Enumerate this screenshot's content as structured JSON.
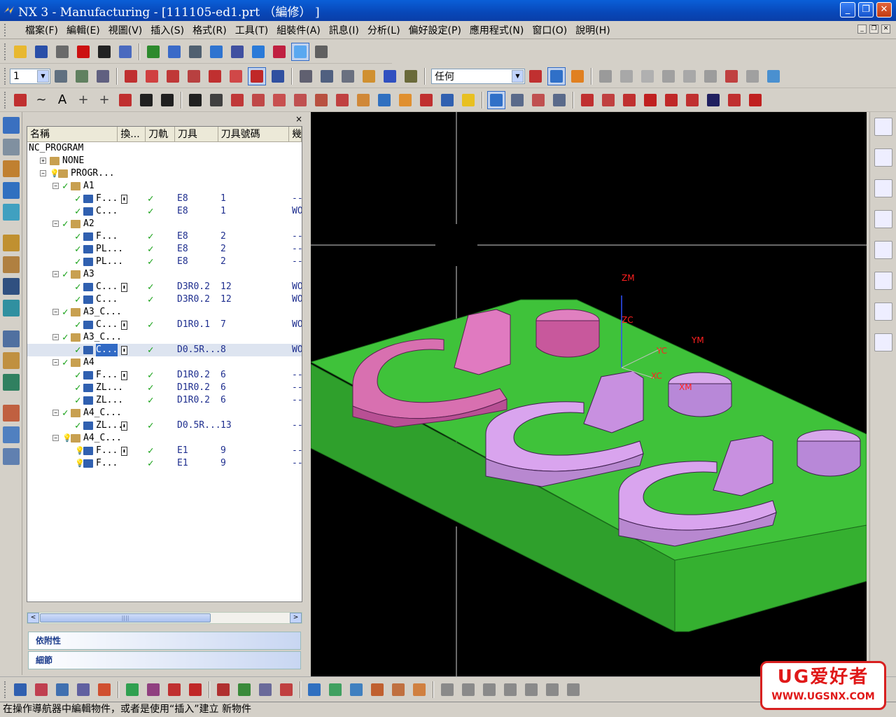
{
  "window": {
    "title": "NX 3 - Manufacturing - [111105-ed1.prt （編修） ]",
    "min_glyph": "_",
    "max_glyph": "❐",
    "close_glyph": "✕"
  },
  "menu": {
    "items": [
      "檔案(F)",
      "編輯(E)",
      "視圖(V)",
      "插入(S)",
      "格式(R)",
      "工具(T)",
      "組裝件(A)",
      "訊息(I)",
      "分析(L)",
      "偏好設定(P)",
      "應用程式(N)",
      "窗口(O)",
      "說明(H)"
    ],
    "mdi_buttons": [
      "_",
      "❐",
      "✕"
    ]
  },
  "toolbar1": {
    "buttons": [
      {
        "name": "open-icon",
        "color": "#e8b830"
      },
      {
        "name": "save-icon",
        "color": "#2a4fa8"
      },
      {
        "name": "print-icon",
        "color": "#6a6a6a"
      },
      {
        "name": "delete-icon",
        "color": "#cc1010"
      },
      {
        "name": "undo-icon",
        "color": "#222222"
      },
      {
        "name": "repeat-icon",
        "color": "#4a6abf"
      },
      {
        "name": "refresh-icon",
        "color": "#2d8a2d"
      },
      {
        "name": "fit-icon",
        "color": "#3a6ac8"
      },
      {
        "name": "orient-icon",
        "color": "#506070"
      },
      {
        "name": "shaded-icon",
        "color": "#2f74d0"
      },
      {
        "name": "wireframe-icon",
        "color": "#4050a0"
      },
      {
        "name": "view-cube-icon",
        "color": "#2a7ad8"
      },
      {
        "name": "render-icon",
        "color": "#c02040"
      },
      {
        "name": "view-front-icon",
        "color": "#5aa8f0"
      },
      {
        "name": "hat-icon",
        "color": "#606060"
      }
    ]
  },
  "toolbar2": {
    "layer_value": "1",
    "filter_value": "任何",
    "buttons": [
      {
        "name": "layer-icon",
        "color": "#607080"
      },
      {
        "name": "move-layer-icon",
        "color": "#608060"
      },
      {
        "name": "copy-layer-icon",
        "color": "#606080"
      },
      {
        "name": "wcs-origin-icon",
        "color": "#c03030"
      },
      {
        "name": "wcs-dynamic-icon",
        "color": "#d04040"
      },
      {
        "name": "wcs-rotate-icon",
        "color": "#c03838"
      },
      {
        "name": "wcs-orient-icon",
        "color": "#b84040"
      },
      {
        "name": "wcs-xc-icon",
        "color": "#c03030"
      },
      {
        "name": "wcs-set-icon",
        "color": "#d04848"
      },
      {
        "name": "wcs-active-icon",
        "color": "#c02828"
      },
      {
        "name": "wcs-save-icon",
        "color": "#3050a0"
      },
      {
        "name": "part-nav-icon",
        "color": "#606070"
      },
      {
        "name": "assy-icon",
        "color": "#506080"
      },
      {
        "name": "assy2-icon",
        "color": "#6a7080"
      },
      {
        "name": "prop-icon",
        "color": "#d09030"
      },
      {
        "name": "measure-icon",
        "color": "#3050c0"
      },
      {
        "name": "ruler-icon",
        "color": "#6a6a3a"
      },
      {
        "name": "snap-point-icon",
        "color": "#c03030"
      },
      {
        "name": "snap-active-icon",
        "color": "#3070c8"
      },
      {
        "name": "snap-box-icon",
        "color": "#e08020"
      },
      {
        "name": "palette-icon",
        "color": "#9a9a9a"
      },
      {
        "name": "point-icon",
        "color": "#a8a8a8"
      },
      {
        "name": "center-icon",
        "color": "#b0b0b0"
      },
      {
        "name": "arc-icon",
        "color": "#a0a0a0"
      },
      {
        "name": "grid-icon",
        "color": "#a8a8a8"
      },
      {
        "name": "chain-icon",
        "color": "#9c9c9c"
      },
      {
        "name": "rotate-icon",
        "color": "#c04040"
      },
      {
        "name": "key-icon",
        "color": "#a0a0a0"
      },
      {
        "name": "cube-icon",
        "color": "#4a90d0"
      }
    ]
  },
  "toolbar3": {
    "buttons": [
      {
        "name": "point-tool-icon",
        "color": "#c03030",
        "glyph": ""
      },
      {
        "name": "spline-icon",
        "color": "#202020",
        "glyph": "~"
      },
      {
        "name": "text-icon",
        "color": "#000000",
        "glyph": "A"
      },
      {
        "name": "point-plus-icon",
        "color": "#404040",
        "glyph": "+"
      },
      {
        "name": "points-icon",
        "color": "#404040",
        "glyph": "+"
      },
      {
        "name": "fillet-icon",
        "color": "#c03030",
        "glyph": ""
      },
      {
        "name": "rect-icon",
        "color": "#202020",
        "glyph": ""
      },
      {
        "name": "polygon-icon",
        "color": "#202020",
        "glyph": ""
      },
      {
        "name": "ellipse-icon",
        "color": "#202020",
        "glyph": ""
      },
      {
        "name": "helix-icon",
        "color": "#404040",
        "glyph": ""
      },
      {
        "name": "curve-op1-icon",
        "color": "#c03838",
        "glyph": ""
      },
      {
        "name": "curve-op2-icon",
        "color": "#c04848",
        "glyph": ""
      },
      {
        "name": "curve-op3-icon",
        "color": "#c85050",
        "glyph": ""
      },
      {
        "name": "curve-op4-icon",
        "color": "#c05050",
        "glyph": ""
      },
      {
        "name": "curve-op5-icon",
        "color": "#b85040",
        "glyph": ""
      },
      {
        "name": "offset-icon",
        "color": "#c04040",
        "glyph": ""
      },
      {
        "name": "bridge-icon",
        "color": "#d08838",
        "glyph": ""
      },
      {
        "name": "project-icon",
        "color": "#3070c0",
        "glyph": ""
      },
      {
        "name": "combine-icon",
        "color": "#e09030",
        "glyph": ""
      },
      {
        "name": "mirror-icon",
        "color": "#c03030",
        "glyph": ""
      },
      {
        "name": "wrap-icon",
        "color": "#3060b0",
        "glyph": ""
      },
      {
        "name": "yellow-arrow-icon",
        "color": "#e8c020",
        "glyph": ""
      },
      {
        "name": "trim-icon",
        "color": "#3070c8",
        "glyph": ""
      },
      {
        "name": "split-icon",
        "color": "#5a6a8a",
        "glyph": ""
      },
      {
        "name": "stretch-icon",
        "color": "#c05050",
        "glyph": ""
      },
      {
        "name": "edit-curve-icon",
        "color": "#5a6a8a",
        "glyph": ""
      },
      {
        "name": "length-icon",
        "color": "#c03030",
        "glyph": ""
      },
      {
        "name": "edit-param-icon",
        "color": "#c04040",
        "glyph": ""
      },
      {
        "name": "trim-corner-icon",
        "color": "#c03030",
        "glyph": ""
      },
      {
        "name": "divide-icon",
        "color": "#c02020",
        "glyph": ""
      },
      {
        "name": "fillet-edit-icon",
        "color": "#c02828",
        "glyph": ""
      },
      {
        "name": "chamfer-icon",
        "color": "#c03030",
        "glyph": ""
      },
      {
        "name": "smooth-icon",
        "color": "#202060",
        "glyph": ""
      },
      {
        "name": "blend-icon",
        "color": "#c03030",
        "glyph": ""
      },
      {
        "name": "spline-edit-icon",
        "color": "#c02020",
        "glyph": ""
      }
    ]
  },
  "navigator": {
    "close_glyph": "×",
    "columns": [
      "名稱",
      "換...",
      "刀軌",
      "刀具",
      "刀具號碼",
      "幾"
    ],
    "rows": [
      {
        "level": 0,
        "expand": "",
        "icon": "",
        "name": "NC_PROGRAM",
        "check": false,
        "bulb": false,
        "tc": false,
        "path": false,
        "tool": "",
        "num": "",
        "geom": "",
        "selected": false
      },
      {
        "level": 1,
        "expand": "+",
        "icon": "#c8a050",
        "name": "NONE",
        "check": false,
        "bulb": false,
        "tc": false,
        "path": false,
        "tool": "",
        "num": "",
        "geom": "",
        "selected": false
      },
      {
        "level": 1,
        "expand": "−",
        "icon": "#c8a050",
        "name": "PROGR...",
        "check": false,
        "bulb": true,
        "tc": false,
        "path": false,
        "tool": "",
        "num": "",
        "geom": "",
        "selected": false
      },
      {
        "level": 2,
        "expand": "−",
        "icon": "#c8a050",
        "name": "A1",
        "check": true,
        "bulb": false,
        "tc": false,
        "path": false,
        "tool": "",
        "num": "",
        "geom": "",
        "selected": false
      },
      {
        "level": 3,
        "expand": "",
        "icon": "#3060b0",
        "name": "F...",
        "check": true,
        "bulb": false,
        "tc": true,
        "path": true,
        "tool": "E8",
        "num": "1",
        "geom": "---",
        "selected": false
      },
      {
        "level": 3,
        "expand": "",
        "icon": "#3060b0",
        "name": "C...",
        "check": true,
        "bulb": false,
        "tc": false,
        "path": true,
        "tool": "E8",
        "num": "1",
        "geom": "WO",
        "selected": false
      },
      {
        "level": 2,
        "expand": "−",
        "icon": "#c8a050",
        "name": "A2",
        "check": true,
        "bulb": false,
        "tc": false,
        "path": false,
        "tool": "",
        "num": "",
        "geom": "",
        "selected": false
      },
      {
        "level": 3,
        "expand": "",
        "icon": "#3060b0",
        "name": "F...",
        "check": true,
        "bulb": false,
        "tc": false,
        "path": true,
        "tool": "E8",
        "num": "2",
        "geom": "---",
        "selected": false
      },
      {
        "level": 3,
        "expand": "",
        "icon": "#3060b0",
        "name": "PL...",
        "check": true,
        "bulb": false,
        "tc": false,
        "path": true,
        "tool": "E8",
        "num": "2",
        "geom": "---",
        "selected": false
      },
      {
        "level": 3,
        "expand": "",
        "icon": "#3060b0",
        "name": "PL...",
        "check": true,
        "bulb": false,
        "tc": false,
        "path": true,
        "tool": "E8",
        "num": "2",
        "geom": "---",
        "selected": false
      },
      {
        "level": 2,
        "expand": "−",
        "icon": "#c8a050",
        "name": "A3",
        "check": true,
        "bulb": false,
        "tc": false,
        "path": false,
        "tool": "",
        "num": "",
        "geom": "",
        "selected": false
      },
      {
        "level": 3,
        "expand": "",
        "icon": "#3060b0",
        "name": "C...",
        "check": true,
        "bulb": false,
        "tc": true,
        "path": true,
        "tool": "D3R0.2",
        "num": "12",
        "geom": "WO",
        "selected": false
      },
      {
        "level": 3,
        "expand": "",
        "icon": "#3060b0",
        "name": "C...",
        "check": true,
        "bulb": false,
        "tc": false,
        "path": true,
        "tool": "D3R0.2",
        "num": "12",
        "geom": "WO",
        "selected": false
      },
      {
        "level": 2,
        "expand": "−",
        "icon": "#c8a050",
        "name": "A3_C...",
        "check": true,
        "bulb": false,
        "tc": false,
        "path": false,
        "tool": "",
        "num": "",
        "geom": "",
        "selected": false
      },
      {
        "level": 3,
        "expand": "",
        "icon": "#3060b0",
        "name": "C...",
        "check": true,
        "bulb": false,
        "tc": true,
        "path": true,
        "tool": "D1R0.1",
        "num": "7",
        "geom": "WO",
        "selected": false
      },
      {
        "level": 2,
        "expand": "−",
        "icon": "#c8a050",
        "name": "A3_C...",
        "check": true,
        "bulb": false,
        "tc": false,
        "path": false,
        "tool": "",
        "num": "",
        "geom": "",
        "selected": false
      },
      {
        "level": 3,
        "expand": "",
        "icon": "#3060b0",
        "name": "C...",
        "check": true,
        "bulb": false,
        "tc": true,
        "path": true,
        "tool": "D0.5R...",
        "num": "8",
        "geom": "WO",
        "selected": true
      },
      {
        "level": 2,
        "expand": "−",
        "icon": "#c8a050",
        "name": "A4",
        "check": true,
        "bulb": false,
        "tc": false,
        "path": false,
        "tool": "",
        "num": "",
        "geom": "",
        "selected": false
      },
      {
        "level": 3,
        "expand": "",
        "icon": "#3060b0",
        "name": "F...",
        "check": true,
        "bulb": false,
        "tc": true,
        "path": true,
        "tool": "D1R0.2",
        "num": "6",
        "geom": "---",
        "selected": false
      },
      {
        "level": 3,
        "expand": "",
        "icon": "#3060b0",
        "name": "ZL...",
        "check": true,
        "bulb": false,
        "tc": false,
        "path": true,
        "tool": "D1R0.2",
        "num": "6",
        "geom": "---",
        "selected": false
      },
      {
        "level": 3,
        "expand": "",
        "icon": "#3060b0",
        "name": "ZL...",
        "check": true,
        "bulb": false,
        "tc": false,
        "path": true,
        "tool": "D1R0.2",
        "num": "6",
        "geom": "---",
        "selected": false
      },
      {
        "level": 2,
        "expand": "−",
        "icon": "#c8a050",
        "name": "A4_C...",
        "check": true,
        "bulb": false,
        "tc": false,
        "path": false,
        "tool": "",
        "num": "",
        "geom": "",
        "selected": false
      },
      {
        "level": 3,
        "expand": "",
        "icon": "#3060b0",
        "name": "ZL...",
        "check": true,
        "bulb": false,
        "tc": true,
        "path": true,
        "tool": "D0.5R...",
        "num": "13",
        "geom": "---",
        "selected": false
      },
      {
        "level": 2,
        "expand": "−",
        "icon": "#c8a050",
        "name": "A4_C...",
        "check": false,
        "bulb": true,
        "tc": false,
        "path": false,
        "tool": "",
        "num": "",
        "geom": "",
        "selected": false
      },
      {
        "level": 3,
        "expand": "",
        "icon": "#3060b0",
        "name": "F...",
        "check": false,
        "bulb": true,
        "tc": true,
        "path": true,
        "tool": "E1",
        "num": "9",
        "geom": "---",
        "selected": false
      },
      {
        "level": 3,
        "expand": "",
        "icon": "#3060b0",
        "name": "F...",
        "check": false,
        "bulb": true,
        "tc": false,
        "path": true,
        "tool": "E1",
        "num": "9",
        "geom": "---",
        "selected": false
      }
    ],
    "scroll_left": "<",
    "scroll_right": ">",
    "scroll_grip": "||||",
    "panel_dependencies": "依附性",
    "panel_details": "細節"
  },
  "viewport": {
    "labels": [
      "ZM",
      "ZC",
      "YC",
      "YM",
      "XC",
      "XM"
    ],
    "colors": {
      "background": "#000000",
      "base": "#3fc23a",
      "base_side": "#2fa02c",
      "part_pink": "#d870b0",
      "part_purple": "#c890e0"
    }
  },
  "right_strip": {
    "buttons": [
      "assembly-nav-icon",
      "constraint-nav-icon",
      "part-nav-icon",
      "web-browser-icon",
      "training-icon",
      "help-icon",
      "history-icon",
      "system-materials-icon"
    ]
  },
  "bottom_toolbar": {
    "buttons": [
      {
        "name": "create-program-icon",
        "color": "#3060b0"
      },
      {
        "name": "create-tool-icon",
        "color": "#c04050"
      },
      {
        "name": "create-geometry-icon",
        "color": "#4070b0"
      },
      {
        "name": "create-method-icon",
        "color": "#6060a0"
      },
      {
        "name": "create-operation-icon",
        "color": "#d05030"
      },
      {
        "name": "generate-icon",
        "color": "#30a050"
      },
      {
        "name": "replay-icon",
        "color": "#904080"
      },
      {
        "name": "verify-icon",
        "color": "#c03030"
      },
      {
        "name": "postprocess-icon",
        "color": "#c02828"
      },
      {
        "name": "shop-doc-icon",
        "color": "#b03030"
      },
      {
        "name": "list-path-icon",
        "color": "#3a8a3a"
      },
      {
        "name": "edit-display-icon",
        "color": "#6a6a9a"
      },
      {
        "name": "transform-icon",
        "color": "#c04040"
      },
      {
        "name": "export-icon",
        "color": "#3070c0"
      },
      {
        "name": "library-icon",
        "color": "#40a060"
      },
      {
        "name": "featureless-icon",
        "color": "#4080c0"
      },
      {
        "name": "cut-region-icon",
        "color": "#c06030"
      },
      {
        "name": "machine-icon",
        "color": "#c07040"
      },
      {
        "name": "sim-icon",
        "color": "#d08040"
      },
      {
        "name": "line-icon",
        "color": "#8a8a8a"
      },
      {
        "name": "line2-icon",
        "color": "#8a8a8a"
      },
      {
        "name": "curve2-icon",
        "color": "#8a8a8a"
      },
      {
        "name": "cross-icon",
        "color": "#8a8a8a"
      },
      {
        "name": "circle-icon",
        "color": "#8a8a8a"
      },
      {
        "name": "circle2-icon",
        "color": "#8a8a8a"
      },
      {
        "name": "plus-icon",
        "color": "#8a8a8a"
      }
    ]
  },
  "status": {
    "text": "在操作導航器中編輯物件，或者是使用“插入”建立 新物件"
  },
  "watermark": {
    "brand": "UG爱好者",
    "url": "WWW.UGSNX.COM"
  }
}
